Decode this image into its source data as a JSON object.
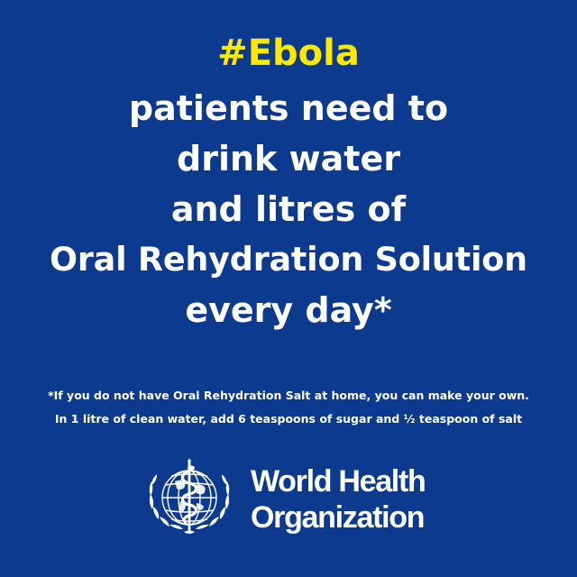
{
  "hashtag": "#Ebola",
  "headline_lines": [
    "patients need to",
    "drink water",
    "and litres of",
    "Oral Rehydration Solution",
    "every day*"
  ],
  "footnote_lines": [
    "*If you do not have Oral Rehydration Salt at home, you can make your own.",
    "In 1 litre of clean water, add 6 teaspoons of sugar and ½ teaspoon of salt"
  ],
  "organization_name_lines": [
    "World Health",
    "Organization"
  ],
  "logo_icon": "who-emblem-icon",
  "colors": {
    "background": "#0b3a8f",
    "hashtag": "#ffe800",
    "text": "#ffffff"
  }
}
